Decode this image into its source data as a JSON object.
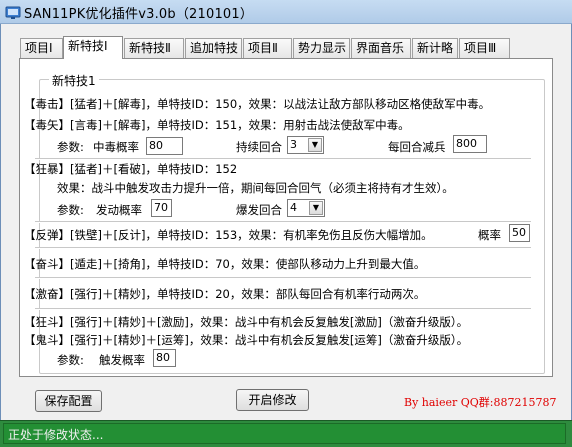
{
  "window": {
    "title": "SAN11PK优化插件v3.0b（210101）"
  },
  "tabs": [
    {
      "label": "项目Ⅰ",
      "active": false
    },
    {
      "label": "新特技Ⅰ",
      "active": true
    },
    {
      "label": "新特技Ⅱ",
      "active": false
    },
    {
      "label": "追加特技",
      "active": false
    },
    {
      "label": "项目Ⅱ",
      "active": false
    },
    {
      "label": "势力显示",
      "active": false
    },
    {
      "label": "界面音乐",
      "active": false
    },
    {
      "label": "新计略",
      "active": false
    },
    {
      "label": "项目Ⅲ",
      "active": false
    }
  ],
  "group": {
    "title": "新特技1"
  },
  "skills": {
    "poison_strike": "【毒击】[猛者]＋[解毒]，单特技ID：150，效果：以战法让敌方部队移动区格使敌军中毒。",
    "poison_arrow": "【毒矢】[言毒]＋[解毒]，单特技ID：151，效果：用射击战法使敌军中毒。",
    "poison_params": {
      "label": "参数:",
      "rate_label": "中毒概率",
      "rate_value": "80",
      "duration_label": "持续回合",
      "duration_value": "3",
      "reduce_label": "每回合减兵",
      "reduce_value": "800"
    },
    "frenzy": "【狂暴】[猛者]＋[看破]，单特技ID：152",
    "frenzy_effect": "效果：战斗中触发攻击力提升一倍，期间每回合回气（必须主将持有才生效）。",
    "frenzy_params": {
      "label": "参数:",
      "rate_label": "发动概率",
      "rate_value": "70",
      "duration_label": "爆发回合",
      "duration_value": "4"
    },
    "rebound": "【反弹】[铁壁]＋[反计]，单特技ID：153，效果：有机率免伤且反伤大幅增加。",
    "rebound_rate_label": "概率",
    "rebound_rate_value": "50",
    "charge": "【奋斗】[遁走]＋[掎角]，单特技ID：70，效果：使部队移动力上升到最大值。",
    "excite": "【激奋】[强行]＋[精妙]，单特技ID：20，效果：部队每回合有机率行动两次。",
    "fury": "【狂斗】[强行]＋[精妙]＋[激励]，效果：战斗中有机会反复触发[激励]（激奋升级版）。",
    "ghost": "【鬼斗】[强行]＋[精妙]＋[运筹]，效果：战斗中有机会反复触发[运筹]（激奋升级版）。",
    "fury_params": {
      "label": "参数:",
      "rate_label": "触发概率",
      "rate_value": "80"
    }
  },
  "buttons": {
    "save": "保存配置",
    "modify": "开启修改"
  },
  "credit": "By haieer  QQ群:887215787",
  "status": {
    "text": "正处于修改状态..."
  },
  "colors": {
    "status_bg": "#238f34",
    "credit": "#e00000",
    "titlebar": "#c6dcf2"
  }
}
